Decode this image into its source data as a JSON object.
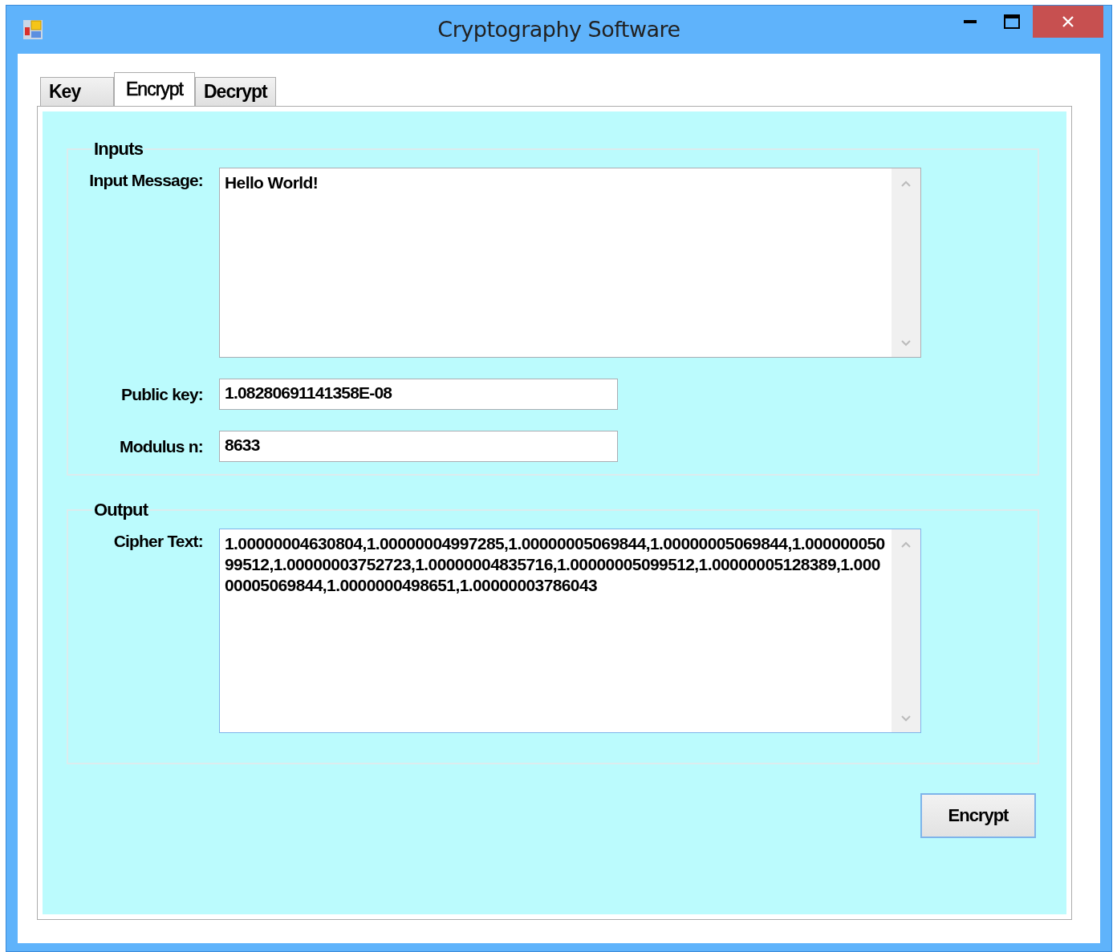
{
  "window": {
    "title": "Cryptography Software"
  },
  "tabs": [
    {
      "label": "Key",
      "selected": false
    },
    {
      "label": "Encrypt",
      "selected": true
    },
    {
      "label": "Decrypt",
      "selected": false
    }
  ],
  "inputs": {
    "title": "Inputs",
    "fields": [
      {
        "label": "Input Message:",
        "value": "Hello World!",
        "kind": "multiline"
      },
      {
        "label": "Public key:",
        "value": "1.08280691141358E-08",
        "kind": "single"
      },
      {
        "label": "Modulus n:",
        "value": "8633",
        "kind": "single"
      }
    ]
  },
  "output": {
    "title": "Output",
    "fields": [
      {
        "label": "Cipher Text:",
        "value": "1.00000004630804,1.00000004997285,1.00000005069844,1.00000005069844,1.00000005099512,1.00000003752723,1.00000004835716,1.00000005099512,1.00000005128389,1.00000005069844,1.0000000498651,1.00000003786043",
        "kind": "multiline",
        "focused": true
      }
    ]
  },
  "button": "Encrypt"
}
